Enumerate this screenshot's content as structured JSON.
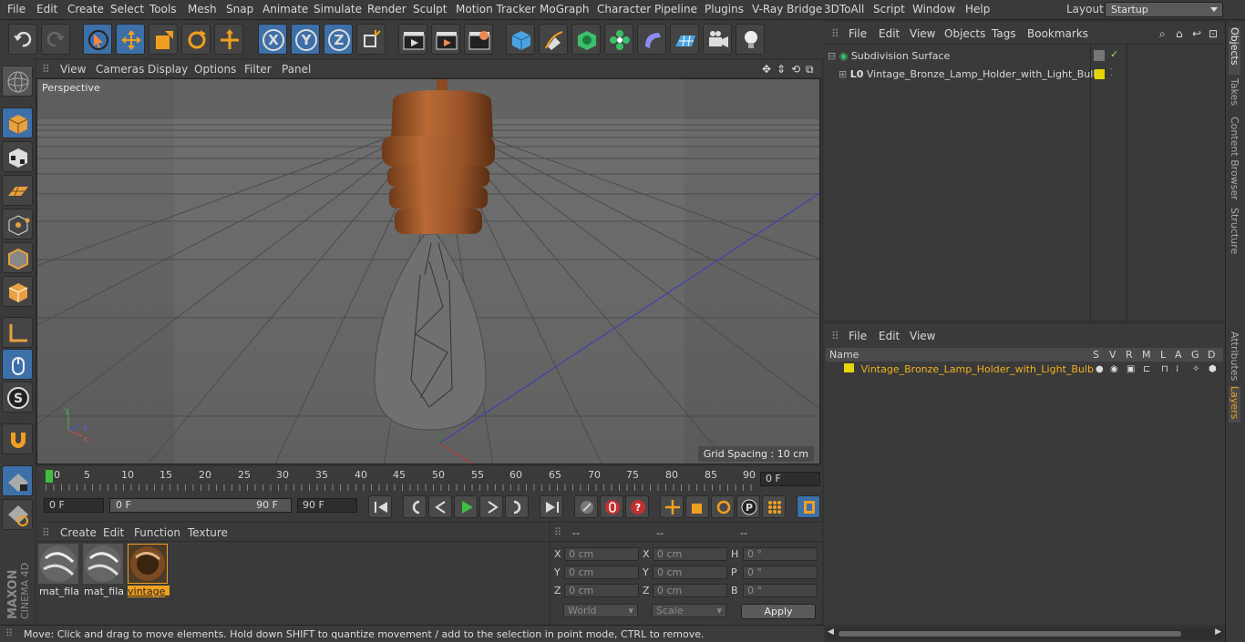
{
  "menubar": {
    "items": [
      "File",
      "Edit",
      "Create",
      "Select",
      "Tools",
      "Mesh",
      "Snap",
      "Animate",
      "Simulate",
      "Render",
      "Sculpt",
      "Motion Tracker",
      "MoGraph",
      "Character",
      "Pipeline",
      "Plugins",
      "V-Ray Bridge",
      "3DToAll",
      "Script",
      "Window",
      "Help"
    ],
    "layout_label": "Layout:",
    "layout_value": "Startup"
  },
  "toolbar": {
    "undo": "undo-icon",
    "redo": "redo-icon"
  },
  "viewport": {
    "menu": [
      "View",
      "Cameras",
      "Display",
      "Options",
      "Filter",
      "Panel"
    ],
    "label": "Perspective",
    "grid_spacing": "Grid Spacing : 10 cm"
  },
  "timeline": {
    "ticks": [
      "0",
      "5",
      "10",
      "15",
      "20",
      "25",
      "30",
      "35",
      "40",
      "45",
      "50",
      "55",
      "60",
      "65",
      "70",
      "75",
      "80",
      "85",
      "90"
    ],
    "current_frame": "0 F",
    "start_field": "0 F",
    "range_start": "0 F",
    "range_end": "90 F",
    "end_field": "90 F"
  },
  "material_manager": {
    "menu": [
      "Create",
      "Edit",
      "Function",
      "Texture"
    ],
    "materials": [
      {
        "label": "mat_fila",
        "selected": false
      },
      {
        "label": "mat_fila",
        "selected": false
      },
      {
        "label": "vintage_",
        "selected": true
      }
    ]
  },
  "coordinates": {
    "headers": [
      "--",
      "--",
      "--"
    ],
    "rows": [
      {
        "a_lbl": "X",
        "a_val": "0 cm",
        "b_lbl": "X",
        "b_val": "0 cm",
        "c_lbl": "H",
        "c_val": "0 °"
      },
      {
        "a_lbl": "Y",
        "a_val": "0 cm",
        "b_lbl": "Y",
        "b_val": "0 cm",
        "c_lbl": "P",
        "c_val": "0 °"
      },
      {
        "a_lbl": "Z",
        "a_val": "0 cm",
        "b_lbl": "Z",
        "b_val": "0 cm",
        "c_lbl": "B",
        "c_val": "0 °"
      }
    ],
    "mode_select": "World",
    "scale_select": "Scale",
    "apply": "Apply"
  },
  "status": "Move: Click and drag to move elements. Hold down SHIFT to quantize movement / add to the selection in point mode, CTRL to remove.",
  "objects_panel": {
    "menu": [
      "File",
      "Edit",
      "View",
      "Objects",
      "Tags",
      "Bookmarks"
    ],
    "items": [
      {
        "name": "Subdivision Surface"
      },
      {
        "name": "Vintage_Bronze_Lamp_Holder_with_Light_Bulb"
      }
    ]
  },
  "layers_panel": {
    "menu": [
      "File",
      "Edit",
      "View"
    ],
    "columns": [
      "Name",
      "S",
      "V",
      "R",
      "M",
      "L",
      "A",
      "G",
      "D"
    ],
    "layer": "Vintage_Bronze_Lamp_Holder_with_Light_Bulb",
    "layer_color": "#e8d400"
  },
  "side_tabs": [
    "Objects",
    "Takes",
    "Content Browser",
    "Structure",
    "Attributes",
    "Layers"
  ],
  "branding": {
    "line1": "MAXON",
    "line2": "CINEMA 4D"
  },
  "colors": {
    "accent": "#3d6fa8",
    "highlight_text": "#f0a020",
    "lamp": "#a0582a"
  }
}
